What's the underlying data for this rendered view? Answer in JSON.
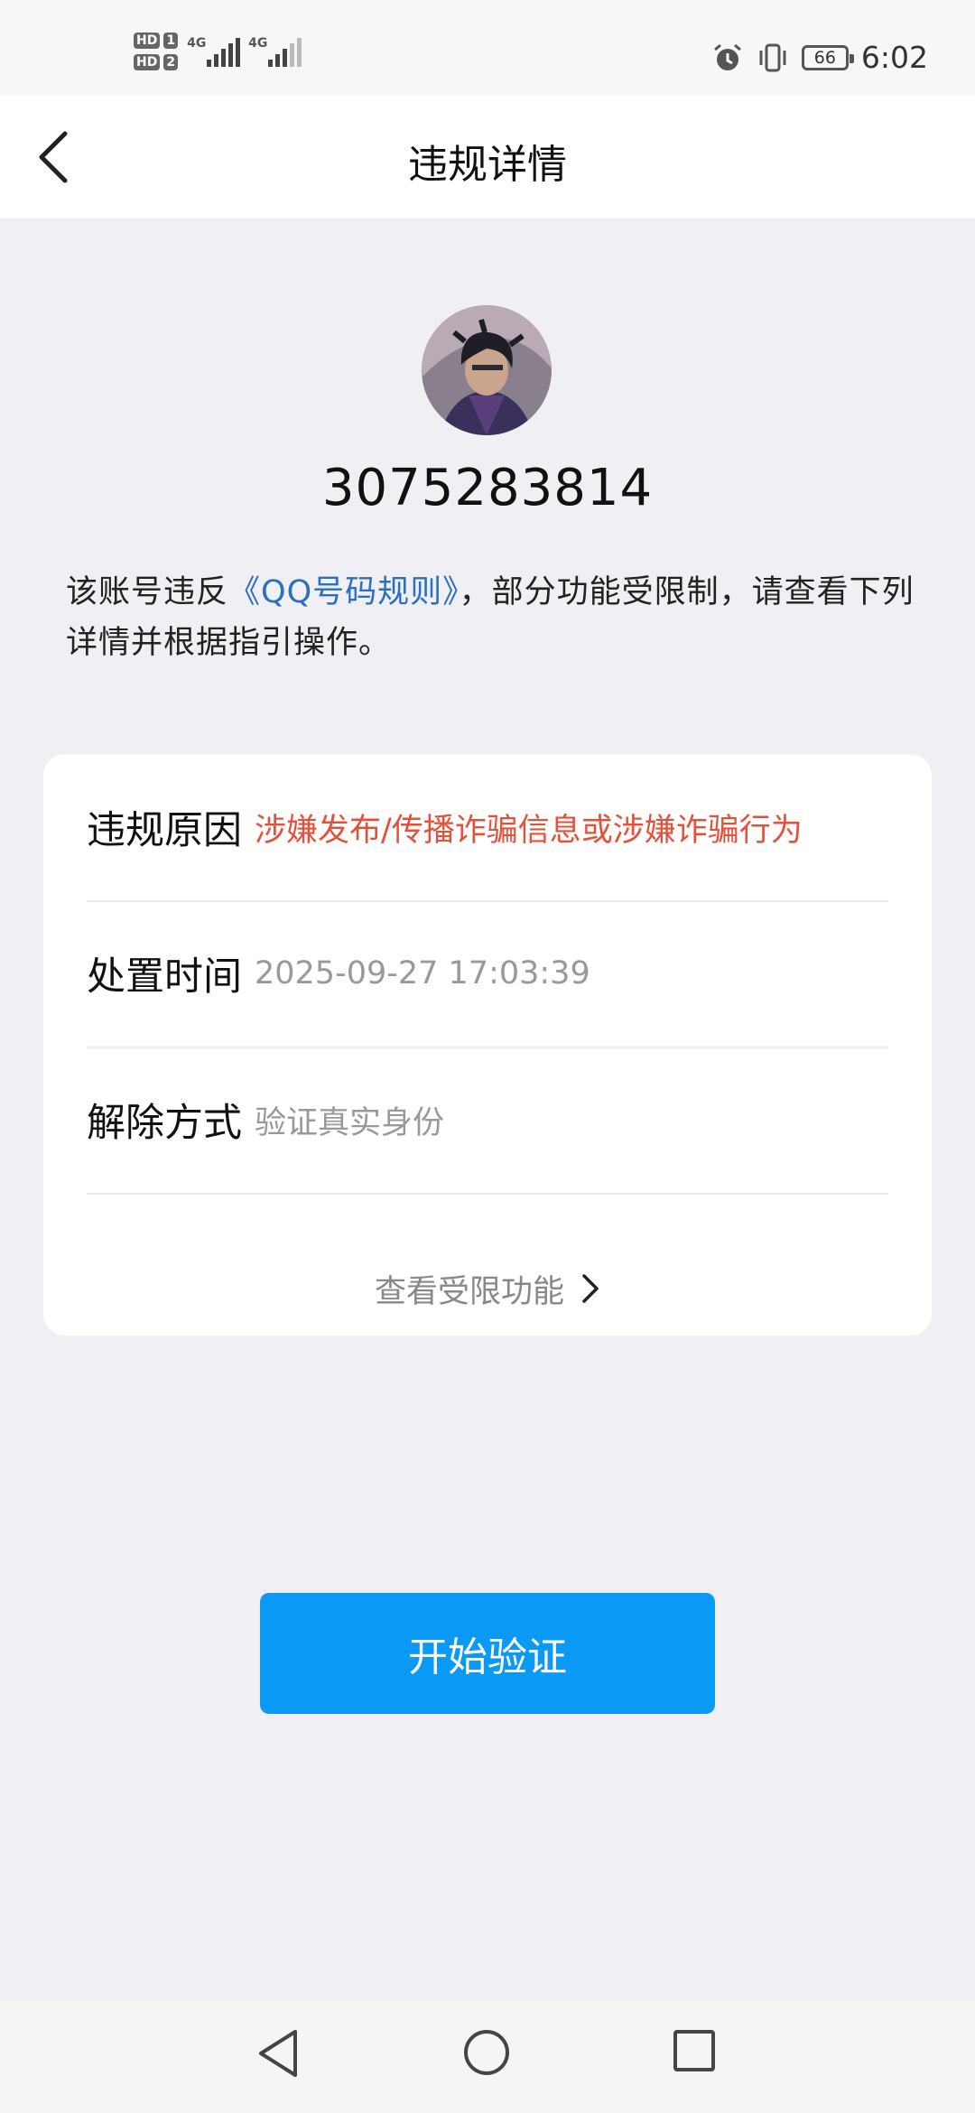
{
  "status_bar": {
    "sim1_label": "HD",
    "sim1_slot": "1",
    "sim2_label": "HD",
    "sim2_slot": "2",
    "network1": "4G",
    "network2": "4G",
    "battery": "66",
    "time": "6:02"
  },
  "nav": {
    "title": "违规详情"
  },
  "profile": {
    "account_number": "3075283814",
    "desc_before": "该账号违反",
    "desc_link": "《QQ号码规则》",
    "desc_after": "，部分功能受限制，请查看下列详情并根据指引操作。"
  },
  "details": {
    "rows": [
      {
        "label": "违规原因",
        "value": "涉嫌发布/传播诈骗信息或涉嫌诈骗行为"
      },
      {
        "label": "处置时间",
        "value": "2025-09-27 17:03:39"
      },
      {
        "label": "解除方式",
        "value": "验证真实身份"
      }
    ],
    "more_link": "查看受限功能"
  },
  "action": {
    "verify_label": "开始验证"
  },
  "colors": {
    "background": "#efeff4",
    "accent_blue": "#0a9af6",
    "link_blue": "#2b6fc1",
    "warning_red": "#e4513b"
  }
}
